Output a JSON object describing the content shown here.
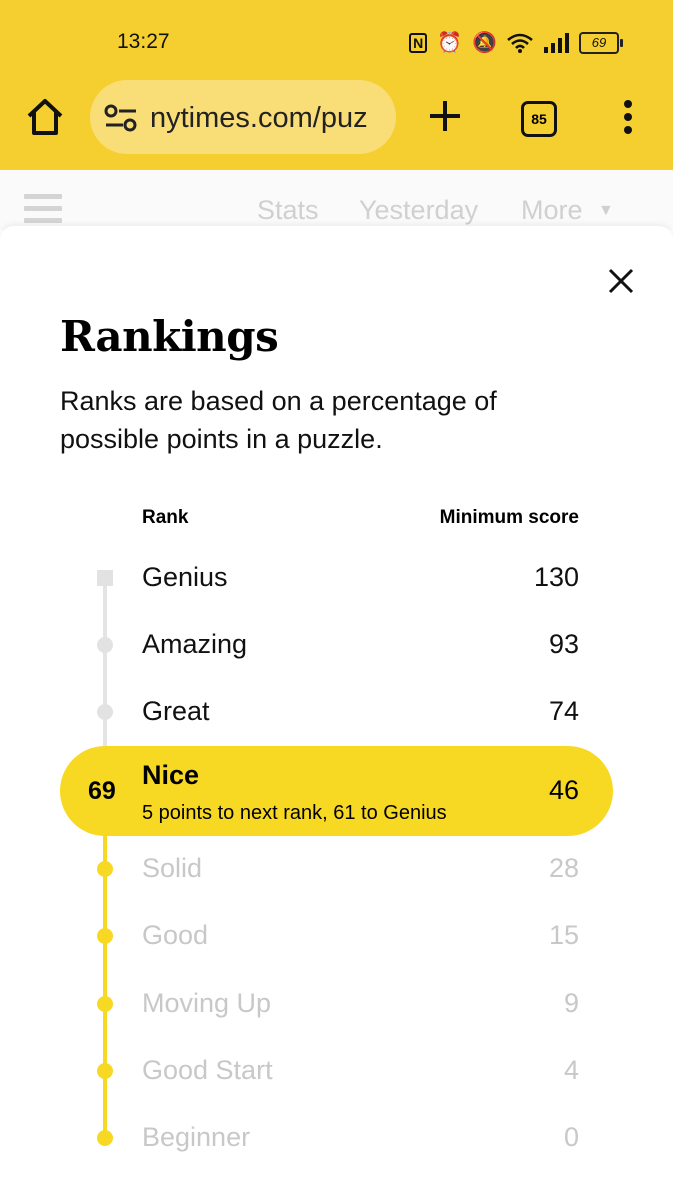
{
  "status": {
    "time": "13:27",
    "battery": "69"
  },
  "browser": {
    "url": "nytimes.com/puz",
    "tab_count": "85"
  },
  "nav": {
    "links": [
      "Stats",
      "Yesterday",
      "More"
    ]
  },
  "modal": {
    "title": "Rankings",
    "description": "Ranks are based on a percentage of possible points in a puzzle.",
    "col_rank": "Rank",
    "col_min": "Minimum score",
    "ranks_above": [
      {
        "name": "Genius",
        "min": "130"
      },
      {
        "name": "Amazing",
        "min": "93"
      },
      {
        "name": "Great",
        "min": "74"
      }
    ],
    "current": {
      "score": "69",
      "name": "Nice",
      "subtitle": "5 points to next rank, 61 to Genius",
      "min": "46"
    },
    "ranks_below": [
      {
        "name": "Solid",
        "min": "28"
      },
      {
        "name": "Good",
        "min": "15"
      },
      {
        "name": "Moving Up",
        "min": "9"
      },
      {
        "name": "Good Start",
        "min": "4"
      },
      {
        "name": "Beginner",
        "min": "0"
      }
    ]
  },
  "colors": {
    "chrome": "#f5cf2f",
    "url_bar": "#f9de78",
    "rank_highlight": "#f7d924",
    "future_dot": "#e2e2e2"
  }
}
